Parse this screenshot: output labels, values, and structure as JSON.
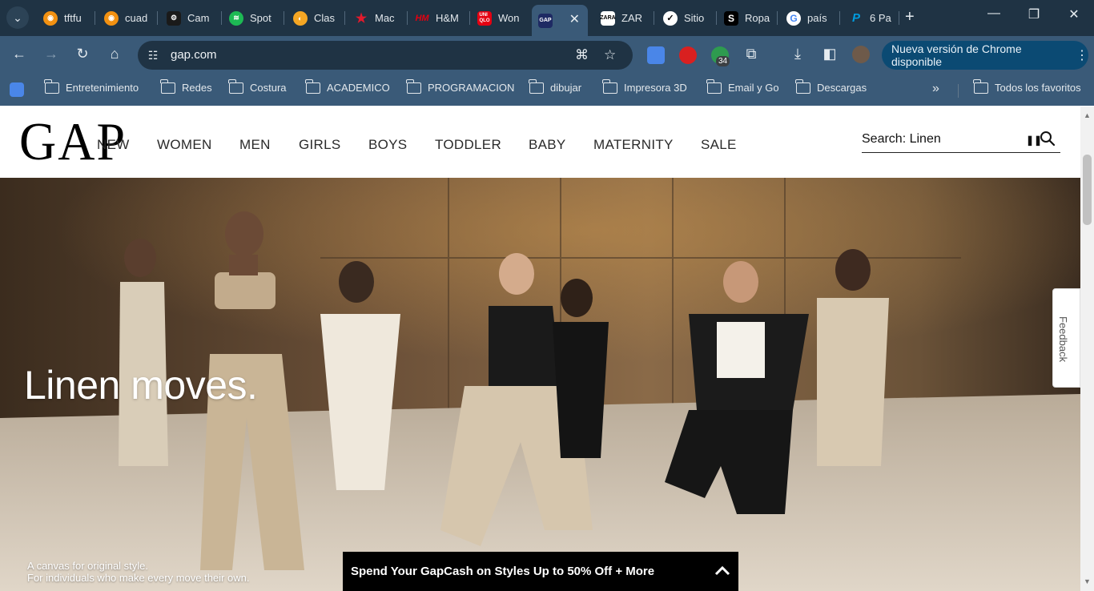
{
  "browser": {
    "tabs": [
      {
        "title": "tftfu",
        "icon": "orange-circle-icon",
        "color": "#f29111"
      },
      {
        "title": "cuad",
        "icon": "orange-circle-icon",
        "color": "#f29111"
      },
      {
        "title": "Cam",
        "icon": "canva-icon",
        "color": "#1a1a1a"
      },
      {
        "title": "Spot",
        "icon": "spotify-icon",
        "color": "#1db954"
      },
      {
        "title": "Clas",
        "icon": "classroom-icon",
        "color": "#f5a623"
      },
      {
        "title": "Mac",
        "icon": "macys-star-icon",
        "color": "#e21a2c"
      },
      {
        "title": "H&M",
        "icon": "hm-icon",
        "color": "#e50010"
      },
      {
        "title": "Won",
        "icon": "uniqlo-icon",
        "color": "#e50012"
      },
      {
        "title": "",
        "icon": "gap-icon",
        "color": "#1e2a63"
      },
      {
        "title": "ZAR",
        "icon": "zara-icon",
        "color": "#ffffff"
      },
      {
        "title": "Sitio",
        "icon": "nike-icon",
        "color": "#ffffff"
      },
      {
        "title": "Ropa",
        "icon": "shein-icon",
        "color": "#000000"
      },
      {
        "title": "país",
        "icon": "google-icon",
        "color": "#ffffff"
      },
      {
        "title": "6 Pa",
        "icon": "paypal-icon",
        "color": "#009cde"
      }
    ],
    "url": "gap.com",
    "extension_badge": "34",
    "update_label": "Nueva versión de Chrome disponible",
    "bookmarks": [
      "Entretenimiento",
      "Redes",
      "Costura",
      "ACADEMICO",
      "PROGRAMACION",
      "dibujar",
      "Impresora 3D",
      "Email y Go",
      "Descargas"
    ],
    "all_bookmarks": "Todos los favoritos",
    "colors": {
      "frame": "#1f3344",
      "toolbar": "#3a5a78",
      "update_pill": "#0b4a73"
    }
  },
  "site": {
    "logo": "GAP",
    "nav": [
      "NEW",
      "WOMEN",
      "MEN",
      "GIRLS",
      "BOYS",
      "TODDLER",
      "BABY",
      "MATERNITY",
      "SALE"
    ],
    "search_label": "Search: Linen",
    "hero": {
      "title": "Linen moves.",
      "subtitle_line1": "A canvas for original style.",
      "subtitle_line2": "For individuals who make every move their own."
    },
    "promo": "Spend Your GapCash on Styles Up to 50% Off + More",
    "feedback": "Feedback"
  }
}
